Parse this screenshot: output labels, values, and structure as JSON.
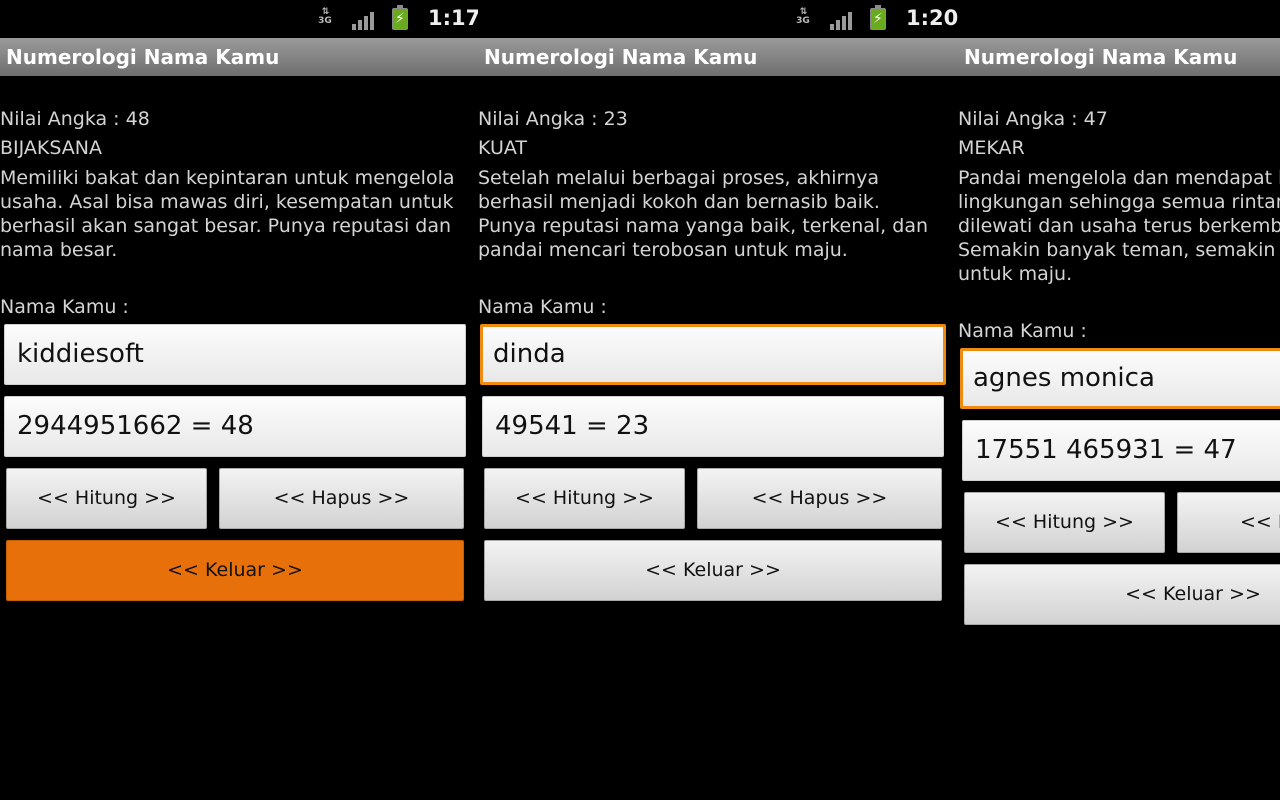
{
  "screens": [
    {
      "status": {
        "network": "3G",
        "time": "1:17"
      },
      "app_title": "Numerologi Nama Kamu",
      "nilai_text": "Nilai Angka : 48",
      "kategori": "BIJAKSANA",
      "deskripsi": "Memiliki bakat dan kepintaran untuk mengelola usaha. Asal bisa mawas diri, kesempatan untuk berhasil akan sangat besar. Punya reputasi dan nama besar.",
      "nama_label": "Nama Kamu :",
      "nama_value": "kiddiesoft",
      "hasil_value": "2944951662 = 48",
      "hitung_label": "<< Hitung >>",
      "hapus_label": "<< Hapus >>",
      "keluar_label": "<< Keluar >>",
      "accent_color": "#e8700a"
    },
    {
      "status": {
        "network": "3G",
        "time": "1:20"
      },
      "app_title": "Numerologi Nama Kamu",
      "nilai_text": "Nilai Angka : 23",
      "kategori": "KUAT",
      "deskripsi": "Setelah melalui berbagai proses, akhirnya berhasil menjadi kokoh dan bernasib baik. Punya reputasi nama yanga baik, terkenal, dan pandai mencari terobosan untuk maju.",
      "nama_label": "Nama Kamu :",
      "nama_value": "dinda",
      "hasil_value": "49541 = 23",
      "hitung_label": "<< Hitung >>",
      "hapus_label": "<< Hapus >>",
      "keluar_label": "<< Keluar >>",
      "focus_color": "#f08a10"
    },
    {
      "app_title": "Numerologi Nama Kamu",
      "nilai_text": "Nilai Angka : 47",
      "kategori": "MEKAR",
      "deskripsi": "Pandai mengelola dan mendapat b lingkungan sehingga semua rintang dilewati dan usaha terus berkemba Semakin banyak teman, semakin te untuk maju.",
      "deskripsi_lines": [
        "Pandai mengelola dan mendapat b",
        "lingkungan sehingga semua rintang",
        "dilewati dan usaha terus berkemba",
        "Semakin banyak teman, semakin te",
        "untuk maju."
      ],
      "nama_label": "Nama Kamu :",
      "nama_value": "agnes monica",
      "hasil_value": "17551 465931 = 47",
      "hitung_label": "<< Hitung >>",
      "hapus_label": "<< H",
      "keluar_label": "<< Keluar >>"
    }
  ]
}
